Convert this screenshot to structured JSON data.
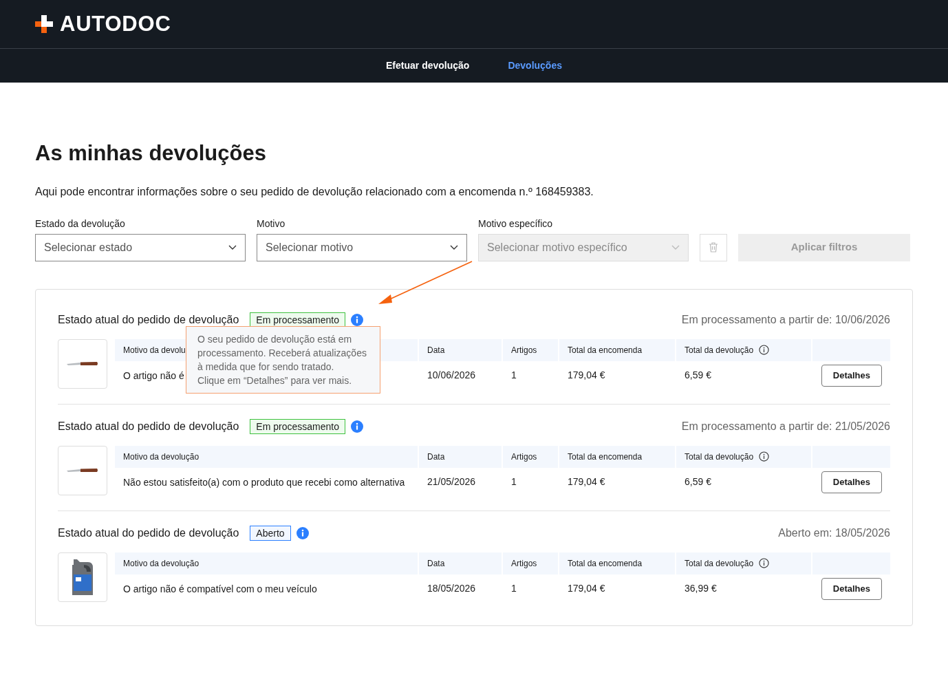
{
  "header": {
    "logo": "AUTODOC"
  },
  "nav": [
    {
      "label": "Efetuar devolução",
      "selected": false
    },
    {
      "label": "Devoluções",
      "selected": true
    }
  ],
  "title": "As minhas devoluções",
  "intro": "Aqui pode encontrar informações sobre o seu pedido de devolução relacionado com a encomenda n.º 168459383.",
  "filters": [
    {
      "label": "Estado da devolução",
      "placeholder": "Selecionar estado",
      "disabled": false
    },
    {
      "label": "Motivo",
      "placeholder": "Selecionar motivo",
      "disabled": false
    },
    {
      "label": "Motivo específico",
      "placeholder": "Selecionar motivo específico",
      "disabled": true
    }
  ],
  "apply_button": {
    "label": "Aplicar filtros",
    "disabled": true
  },
  "returns": [
    {
      "heading": "Estado atual do pedido de devolução",
      "status": {
        "label": "Em processamento",
        "kind": "processing"
      },
      "since": "Em processamento a partir de: 10/06/2026",
      "kind": "knife",
      "columns": [
        "Motivo da devolu",
        "Data",
        "Artigos",
        "Total da encomenda",
        "Total da devolução"
      ],
      "reason": "O artigo não é",
      "date": "10/06/2026",
      "items": "1",
      "order_total": "179,04 €",
      "return_total": "6,59 €",
      "button": "Detalhes",
      "tooltip": [
        "O seu pedido de devolução está em processamento. Receberá atualizações à medida que for sendo tratado.",
        "Clique em “Detalhes” para ver mais."
      ]
    },
    {
      "heading": "Estado atual do pedido de devolução",
      "status": {
        "label": "Em processamento",
        "kind": "processing"
      },
      "since": "Em processamento a partir de: 21/05/2026",
      "kind": "knife",
      "columns": [
        "Motivo da devolução",
        "Data",
        "Artigos",
        "Total da encomenda",
        "Total da devolução"
      ],
      "reason": "Não estou satisfeito(a) com o produto que recebi como alternativa",
      "date": "21/05/2026",
      "items": "1",
      "order_total": "179,04 €",
      "return_total": "6,59 €",
      "button": "Detalhes"
    },
    {
      "heading": "Estado atual do pedido de devolução",
      "status": {
        "label": "Aberto",
        "kind": "open"
      },
      "since": "Aberto em: 18/05/2026",
      "kind": "canister",
      "columns": [
        "Motivo da devolução",
        "Data",
        "Artigos",
        "Total da encomenda",
        "Total da devolução"
      ],
      "reason": "O artigo não é compatível com o meu veículo",
      "date": "18/05/2026",
      "items": "1",
      "order_total": "179,04 €",
      "return_total": "36,99 €",
      "button": "Detalhes"
    }
  ]
}
